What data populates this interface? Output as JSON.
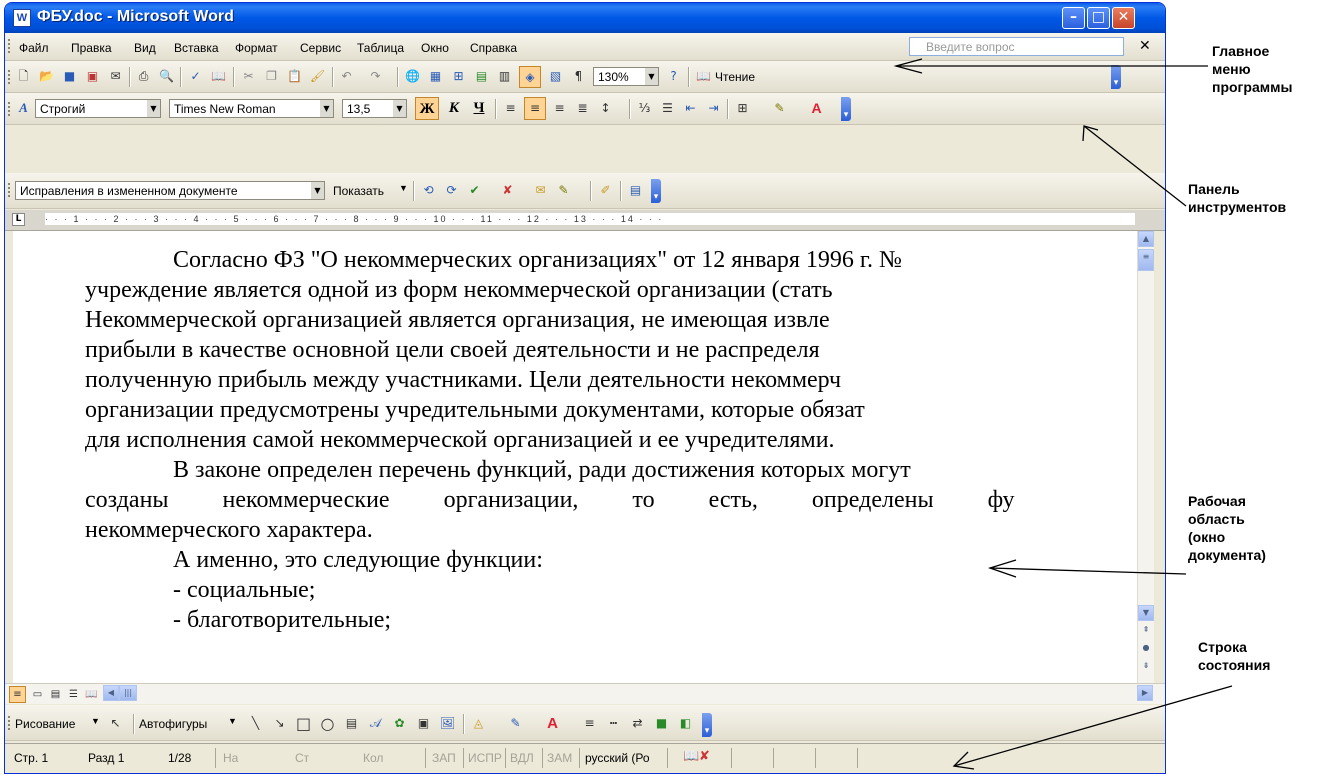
{
  "window": {
    "title": "ФБУ.doc - Microsoft Word",
    "app_icon_letter": "W"
  },
  "menu": {
    "items": [
      "Файл",
      "Правка",
      "Вид",
      "Вставка",
      "Формат",
      "Сервис",
      "Таблица",
      "Окно",
      "Справка"
    ],
    "question_placeholder": "Введите вопрос"
  },
  "standard_toolbar": {
    "zoom": "130%",
    "reading_button": "Чтение"
  },
  "formatting_toolbar": {
    "style": "Строгий",
    "font": "Times New Roman",
    "size": "13,5",
    "bold": "Ж",
    "italic": "К",
    "underline": "Ч"
  },
  "review_toolbar": {
    "mode": "Исправления в измененном документе",
    "show_button": "Показать"
  },
  "document": {
    "lines": [
      "Согласно ФЗ \"О некоммерческих организациях\" от 12 января 1996 г. №",
      "учреждение является одной из форм некоммерческой организации (стать",
      "Некоммерческой организацией является организация, не имеющая извле",
      "прибыли в качестве основной цели своей деятельности и не распределя",
      "полученную прибыль между участниками. Цели деятельности некоммерч",
      "организации предусмотрены учредительными документами, которые обязат",
      "для исполнения самой некоммерческой организацией и ее учредителями.",
      "В законе определен перечень функций, ради достижения которых могут",
      "созданы некоммерческие организации, то есть, определены фу",
      "некоммерческого характера.",
      "А именно, это следующие функции:",
      "-  социальные;",
      "-  благотворительные;"
    ]
  },
  "drawing_toolbar": {
    "draw_button": "Рисование",
    "autoshapes_button": "Автофигуры"
  },
  "status_bar": {
    "page": "Стр. 1",
    "section": "Разд 1",
    "pages": "1/28",
    "at": "На",
    "line": "Ст",
    "col": "Кол",
    "rec": "ЗАП",
    "trk": "ИСПР",
    "ext": "ВДЛ",
    "ovr": "ЗАМ",
    "language": "русский (Ро"
  },
  "annotations": {
    "main_menu": [
      "Главное",
      "меню",
      "программы"
    ],
    "toolbar": [
      "Панель",
      "инструментов"
    ],
    "workspace": [
      "Рабочая",
      "область",
      "(окно",
      "документа)"
    ],
    "status": [
      "Строка",
      "состояния"
    ]
  }
}
